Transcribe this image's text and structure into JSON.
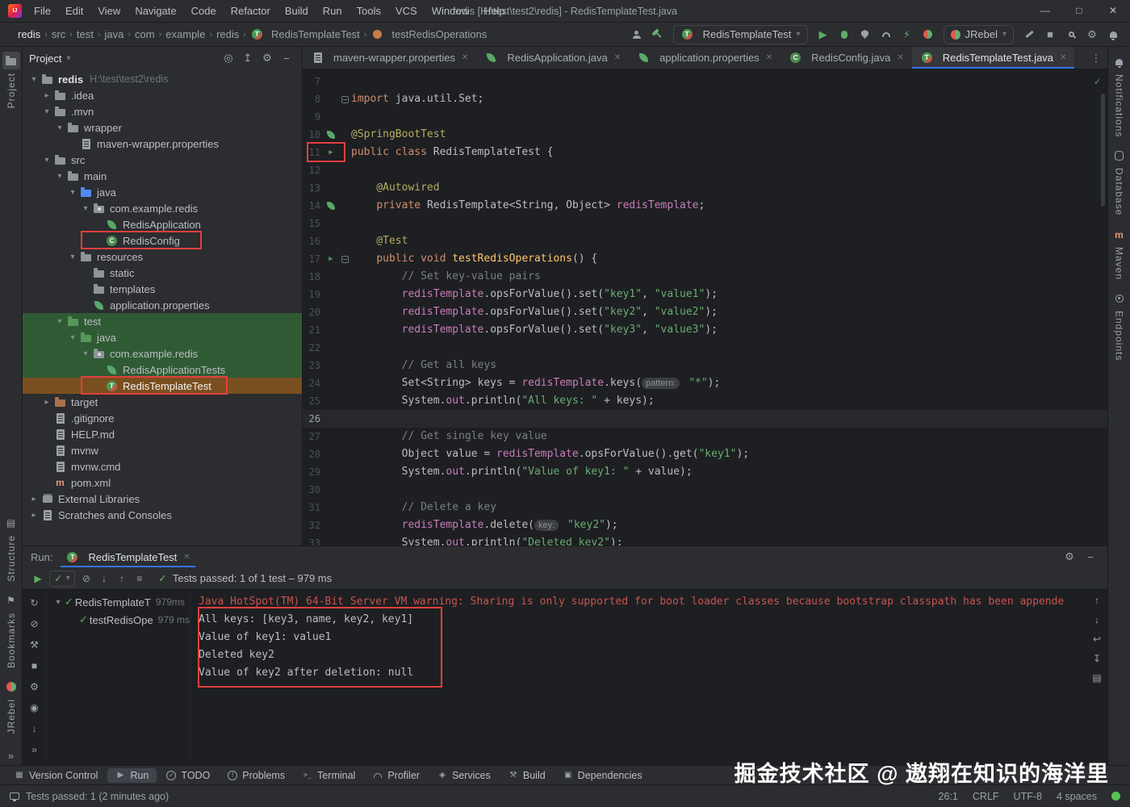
{
  "colors": {
    "accent_blue": "#3574f0",
    "run_green": "#5fad65",
    "annotation_red": "#e33e3e",
    "tree_green_highlight": "#2f5b34",
    "tree_orange_highlight": "#7a4f1f",
    "stderr_red": "#c75450"
  },
  "title_bar": {
    "menus": [
      "File",
      "Edit",
      "View",
      "Navigate",
      "Code",
      "Refactor",
      "Build",
      "Run",
      "Tools",
      "VCS",
      "Window",
      "Help"
    ],
    "title": "redis [H:\\test\\test2\\redis] - RedisTemplateTest.java",
    "window_controls": [
      "minimize",
      "maximize",
      "close"
    ]
  },
  "navbar": {
    "breadcrumbs": [
      {
        "label": "redis"
      },
      {
        "label": "src"
      },
      {
        "label": "test"
      },
      {
        "label": "java"
      },
      {
        "label": "com"
      },
      {
        "label": "example"
      },
      {
        "label": "redis"
      },
      {
        "label": "RedisTemplateTest",
        "icon": "test-class"
      },
      {
        "label": "testRedisOperations",
        "icon": "test-method"
      }
    ],
    "icons_left": [
      "collaboration",
      "build-hammer"
    ],
    "run_config_label": "RedisTemplateTest",
    "icons_mid": [
      "run",
      "debug",
      "coverage",
      "profiler",
      "jrebel-run",
      "jrebel-debug"
    ],
    "jrebel_label": "JRebel",
    "icons_right": [
      "cleanup",
      "stop",
      "search",
      "settings",
      "notifications"
    ]
  },
  "project_panel": {
    "title": "Project",
    "header_icons": [
      {
        "name": "select-opened-file",
        "glyph": "◎"
      },
      {
        "name": "collapse-all",
        "glyph": "↥"
      },
      {
        "name": "settings-gear",
        "glyph": "⚙"
      },
      {
        "name": "hide",
        "glyph": "−"
      }
    ],
    "tree": [
      {
        "label": "redis",
        "path": "H:\\test\\test2\\redis",
        "level": 0,
        "icon": "folder",
        "chevron": "down",
        "bold": true
      },
      {
        "label": ".idea",
        "level": 1,
        "icon": "folder",
        "chevron": "right"
      },
      {
        "label": ".mvn",
        "level": 1,
        "icon": "folder",
        "chevron": "down"
      },
      {
        "label": "wrapper",
        "level": 2,
        "icon": "folder",
        "chevron": "down"
      },
      {
        "label": "maven-wrapper.properties",
        "level": 3,
        "icon": "props"
      },
      {
        "label": "src",
        "level": 1,
        "icon": "folder",
        "chevron": "down"
      },
      {
        "label": "main",
        "level": 2,
        "icon": "folder",
        "chevron": "down"
      },
      {
        "label": "java",
        "level": 3,
        "icon": "folder-blue",
        "chevron": "down"
      },
      {
        "label": "com.example.redis",
        "level": 4,
        "icon": "package",
        "chevron": "down"
      },
      {
        "label": "RedisApplication",
        "level": 5,
        "icon": "spring"
      },
      {
        "label": "RedisConfig",
        "level": 5,
        "icon": "config-class"
      },
      {
        "label": "resources",
        "level": 3,
        "icon": "folder",
        "chevron": "down"
      },
      {
        "label": "static",
        "level": 4,
        "icon": "folder"
      },
      {
        "label": "templates",
        "level": 4,
        "icon": "folder"
      },
      {
        "label": "application.properties",
        "level": 4,
        "icon": "spring-props"
      },
      {
        "label": "test",
        "level": 2,
        "icon": "folder-green",
        "chevron": "down",
        "hl": "green"
      },
      {
        "label": "java",
        "level": 3,
        "icon": "folder-green",
        "chevron": "down",
        "hl": "green"
      },
      {
        "label": "com.example.redis",
        "level": 4,
        "icon": "package",
        "chevron": "down",
        "hl": "green"
      },
      {
        "label": "RedisApplicationTests",
        "level": 5,
        "icon": "spring",
        "hl": "green"
      },
      {
        "label": "RedisTemplateTest",
        "level": 5,
        "icon": "test-class",
        "hl": "orange"
      },
      {
        "label": "target",
        "level": 1,
        "icon": "folder-excluded",
        "chevron": "right"
      },
      {
        "label": ".gitignore",
        "level": 1,
        "icon": "file"
      },
      {
        "label": "HELP.md",
        "level": 1,
        "icon": "file"
      },
      {
        "label": "mvnw",
        "level": 1,
        "icon": "file"
      },
      {
        "label": "mvnw.cmd",
        "level": 1,
        "icon": "file"
      },
      {
        "label": "pom.xml",
        "level": 1,
        "icon": "maven"
      },
      {
        "label": "External Libraries",
        "level": 0,
        "icon": "lib",
        "chevron": "right"
      },
      {
        "label": "Scratches and Consoles",
        "level": 0,
        "icon": "scratch",
        "chevron": "right"
      }
    ]
  },
  "editor": {
    "tabs": [
      {
        "label": "maven-wrapper.properties",
        "icon": "props"
      },
      {
        "label": "RedisApplication.java",
        "icon": "spring"
      },
      {
        "label": "application.properties",
        "icon": "spring-props"
      },
      {
        "label": "RedisConfig.java",
        "icon": "config-class"
      },
      {
        "label": "RedisTemplateTest.java",
        "icon": "test-class",
        "active": true
      }
    ],
    "lines": [
      {
        "n": 7,
        "t": []
      },
      {
        "n": 8,
        "fold": true,
        "t": [
          [
            "kw",
            "import "
          ],
          [
            "pl",
            "java.util.Set;"
          ]
        ]
      },
      {
        "n": 9,
        "t": []
      },
      {
        "n": 10,
        "gut": "spring",
        "t": [
          [
            "ann",
            "@SpringBootTest"
          ]
        ]
      },
      {
        "n": 11,
        "gut": "run",
        "t": [
          [
            "kw",
            "public class "
          ],
          [
            "pl",
            "RedisTemplateTest {"
          ]
        ]
      },
      {
        "n": 12,
        "t": []
      },
      {
        "n": 13,
        "t": [
          [
            "pl",
            "    "
          ],
          [
            "ann",
            "@Autowired"
          ]
        ]
      },
      {
        "n": 14,
        "gut": "spring",
        "t": [
          [
            "pl",
            "    "
          ],
          [
            "kw",
            "private "
          ],
          [
            "pl",
            "RedisTemplate<String, Object> "
          ],
          [
            "fld",
            "redisTemplate"
          ],
          [
            "pl",
            ";"
          ]
        ]
      },
      {
        "n": 15,
        "t": []
      },
      {
        "n": 16,
        "t": [
          [
            "pl",
            "    "
          ],
          [
            "ann",
            "@Test"
          ]
        ]
      },
      {
        "n": 17,
        "gut": "run",
        "fold": true,
        "t": [
          [
            "pl",
            "    "
          ],
          [
            "kw",
            "public void "
          ],
          [
            "mth",
            "testRedisOperations"
          ],
          [
            "pl",
            "() {"
          ]
        ]
      },
      {
        "n": 18,
        "t": [
          [
            "pl",
            "        "
          ],
          [
            "cmt",
            "// Set key-value pairs"
          ]
        ]
      },
      {
        "n": 19,
        "t": [
          [
            "pl",
            "        "
          ],
          [
            "fld",
            "redisTemplate"
          ],
          [
            "pl",
            ".opsForValue().set("
          ],
          [
            "str",
            "\"key1\""
          ],
          [
            "pl",
            ", "
          ],
          [
            "str",
            "\"value1\""
          ],
          [
            "pl",
            ");"
          ]
        ]
      },
      {
        "n": 20,
        "t": [
          [
            "pl",
            "        "
          ],
          [
            "fld",
            "redisTemplate"
          ],
          [
            "pl",
            ".opsForValue().set("
          ],
          [
            "str",
            "\"key2\""
          ],
          [
            "pl",
            ", "
          ],
          [
            "str",
            "\"value2\""
          ],
          [
            "pl",
            ");"
          ]
        ]
      },
      {
        "n": 21,
        "t": [
          [
            "pl",
            "        "
          ],
          [
            "fld",
            "redisTemplate"
          ],
          [
            "pl",
            ".opsForValue().set("
          ],
          [
            "str",
            "\"key3\""
          ],
          [
            "pl",
            ", "
          ],
          [
            "str",
            "\"value3\""
          ],
          [
            "pl",
            ");"
          ]
        ]
      },
      {
        "n": 22,
        "t": []
      },
      {
        "n": 23,
        "t": [
          [
            "pl",
            "        "
          ],
          [
            "cmt",
            "// Get all keys"
          ]
        ]
      },
      {
        "n": 24,
        "t": [
          [
            "pl",
            "        Set<String> keys = "
          ],
          [
            "fld",
            "redisTemplate"
          ],
          [
            "pl",
            ".keys("
          ],
          [
            "hint",
            "pattern:"
          ],
          [
            "pl",
            " "
          ],
          [
            "str",
            "\"*\""
          ],
          [
            "pl",
            ");"
          ]
        ]
      },
      {
        "n": 25,
        "t": [
          [
            "pl",
            "        System."
          ],
          [
            "fld",
            "out"
          ],
          [
            "pl",
            ".println("
          ],
          [
            "str",
            "\"All keys: \""
          ],
          [
            "pl",
            " + keys);"
          ]
        ]
      },
      {
        "n": 26,
        "current": true,
        "t": []
      },
      {
        "n": 27,
        "t": [
          [
            "pl",
            "        "
          ],
          [
            "cmt",
            "// Get single key value"
          ]
        ]
      },
      {
        "n": 28,
        "t": [
          [
            "pl",
            "        Object value = "
          ],
          [
            "fld",
            "redisTemplate"
          ],
          [
            "pl",
            ".opsForValue().get("
          ],
          [
            "str",
            "\"key1\""
          ],
          [
            "pl",
            ");"
          ]
        ]
      },
      {
        "n": 29,
        "t": [
          [
            "pl",
            "        System."
          ],
          [
            "fld",
            "out"
          ],
          [
            "pl",
            ".println("
          ],
          [
            "str",
            "\"Value of key1: \""
          ],
          [
            "pl",
            " + value);"
          ]
        ]
      },
      {
        "n": 30,
        "t": []
      },
      {
        "n": 31,
        "t": [
          [
            "pl",
            "        "
          ],
          [
            "cmt",
            "// Delete a key"
          ]
        ]
      },
      {
        "n": 32,
        "t": [
          [
            "pl",
            "        "
          ],
          [
            "fld",
            "redisTemplate"
          ],
          [
            "pl",
            ".delete("
          ],
          [
            "hint",
            "key:"
          ],
          [
            "pl",
            " "
          ],
          [
            "str",
            "\"key2\""
          ],
          [
            "pl",
            ");"
          ]
        ]
      },
      {
        "n": 33,
        "t": [
          [
            "pl",
            "        System."
          ],
          [
            "fld",
            "out"
          ],
          [
            "pl",
            ".println("
          ],
          [
            "str",
            "\"Deleted key2\""
          ],
          [
            "pl",
            ");"
          ]
        ]
      }
    ]
  },
  "run_panel": {
    "label": "Run:",
    "tab_label": "RedisTemplateTest",
    "header_icons": [
      {
        "name": "settings-gear",
        "glyph": "⚙"
      },
      {
        "name": "hide",
        "glyph": "−"
      }
    ],
    "toolbar_icons": [
      {
        "name": "rerun-tests",
        "glyph": "▶",
        "color": "green"
      },
      {
        "name": "auto-test-combo",
        "glyph": "✓",
        "combo": true
      },
      {
        "name": "stop",
        "glyph": "⊘"
      },
      {
        "name": "sort-alphabetically",
        "glyph": "↓"
      },
      {
        "name": "sort-by-duration",
        "glyph": "↑"
      },
      {
        "name": "show-passed",
        "glyph": "≡"
      }
    ],
    "summary": "Tests passed: 1 of 1 test – 979 ms",
    "left_toolbar_icons": [
      {
        "name": "rerun",
        "glyph": "↻"
      },
      {
        "name": "rerun-failed",
        "glyph": "⊘"
      },
      {
        "name": "test-settings-wrench",
        "glyph": "⚒"
      },
      {
        "name": "stop-process",
        "glyph": "■"
      },
      {
        "name": "settings-gear",
        "glyph": "⚙"
      },
      {
        "name": "thread-dump",
        "glyph": "◉"
      },
      {
        "name": "import-test-results",
        "glyph": "↓"
      },
      {
        "name": "more",
        "glyph": "»"
      }
    ],
    "tests": [
      {
        "label": "RedisTemplateT",
        "time": "979ms",
        "level": 0,
        "chevron": true
      },
      {
        "label": "testRedisOpe",
        "time": "979 ms",
        "level": 1
      }
    ],
    "console": [
      {
        "stream": "stderr",
        "text": "Java HotSpot(TM) 64-Bit Server VM warning: Sharing is only supported for boot loader classes because bootstrap classpath has been appende"
      },
      {
        "stream": "stdout",
        "text": "All keys: [key3, name, key2, key1]"
      },
      {
        "stream": "stdout",
        "text": "Value of key1: value1"
      },
      {
        "stream": "stdout",
        "text": "Deleted key2"
      },
      {
        "stream": "stdout",
        "text": "Value of key2 after deletion: null"
      }
    ],
    "console_toolbar_icons": [
      {
        "name": "scroll-up",
        "glyph": "↑"
      },
      {
        "name": "scroll-down",
        "glyph": "↓"
      },
      {
        "name": "soft-wrap",
        "glyph": "↩"
      },
      {
        "name": "scroll-to-end",
        "glyph": "↧"
      },
      {
        "name": "print",
        "glyph": "▤"
      }
    ]
  },
  "bottom_bar": {
    "items": [
      {
        "label": "Version Control",
        "icon": "vcs"
      },
      {
        "label": "Run",
        "icon": "run",
        "active": true
      },
      {
        "label": "TODO",
        "icon": "todo"
      },
      {
        "label": "Problems",
        "icon": "problems"
      },
      {
        "label": "Terminal",
        "icon": "terminal"
      },
      {
        "label": "Profiler",
        "icon": "profiler"
      },
      {
        "label": "Services",
        "icon": "services"
      },
      {
        "label": "Build",
        "icon": "build"
      },
      {
        "label": "Dependencies",
        "icon": "dependencies"
      }
    ]
  },
  "status_bar": {
    "message": "Tests passed: 1 (2 minutes ago)",
    "caret": "26:1",
    "line_separator": "CRLF",
    "encoding": "UTF-8",
    "indent": "4 spaces"
  },
  "watermark": "掘金技术社区 @ 遨翔在知识的海洋里",
  "left_stripe": {
    "top": [
      {
        "label": "Project",
        "icon": "project-folder",
        "active": true
      }
    ],
    "bottom": [
      {
        "label": "Structure",
        "icon": "structure"
      },
      {
        "label": "Bookmarks",
        "icon": "bookmark"
      },
      {
        "label": "JRebel",
        "icon": "jrebel"
      }
    ]
  },
  "right_stripe": [
    {
      "label": "Notifications",
      "icon": "bell"
    },
    {
      "label": "Database",
      "icon": "database"
    },
    {
      "label": "Maven",
      "icon": "maven"
    },
    {
      "label": "Endpoints",
      "icon": "endpoints"
    }
  ]
}
